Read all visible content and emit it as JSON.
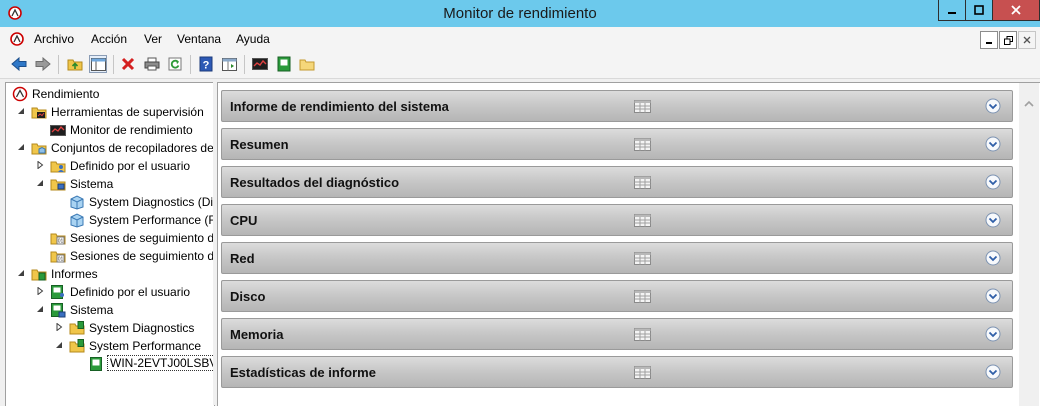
{
  "window": {
    "title": "Monitor de rendimiento",
    "icon": "perfmon-app-icon"
  },
  "menubar": {
    "items": [
      "Archivo",
      "Acción",
      "Ver",
      "Ventana",
      "Ayuda"
    ]
  },
  "toolbar": {
    "buttons": [
      "back-icon",
      "forward-icon",
      "up-folder-icon",
      "show-hide-tree-icon",
      "delete-icon",
      "print-icon",
      "refresh-icon",
      "help-icon",
      "properties-icon",
      "monitor-icon",
      "report-icon",
      "folder-icon"
    ]
  },
  "tree": {
    "items": [
      {
        "label": "Rendimiento",
        "icon": "perfmon-icon",
        "level": 0,
        "expander": ""
      },
      {
        "label": "Herramientas de supervisión",
        "icon": "tools-folder-icon",
        "level": 1,
        "expander": "expanded"
      },
      {
        "label": "Monitor de rendimiento",
        "icon": "graph-icon",
        "level": 2,
        "expander": ""
      },
      {
        "label": "Conjuntos de recopiladores de",
        "icon": "collector-folder-icon",
        "level": 1,
        "expander": "expanded"
      },
      {
        "label": "Definido por el usuario",
        "icon": "user-folder-icon",
        "level": 2,
        "expander": "collapsed"
      },
      {
        "label": "Sistema",
        "icon": "system-folder-icon",
        "level": 2,
        "expander": "expanded"
      },
      {
        "label": "System Diagnostics (Di",
        "icon": "data-collector-icon",
        "level": 3,
        "expander": ""
      },
      {
        "label": "System Performance (F",
        "icon": "data-collector-icon",
        "level": 3,
        "expander": ""
      },
      {
        "label": "Sesiones de seguimiento d",
        "icon": "trace-folder-icon",
        "level": 2,
        "expander": ""
      },
      {
        "label": "Sesiones de seguimiento d",
        "icon": "trace-folder-icon",
        "level": 2,
        "expander": ""
      },
      {
        "label": "Informes",
        "icon": "reports-folder-icon",
        "level": 1,
        "expander": "expanded"
      },
      {
        "label": "Definido por el usuario",
        "icon": "user-report-icon",
        "level": 2,
        "expander": "collapsed"
      },
      {
        "label": "Sistema",
        "icon": "system-report-icon",
        "level": 2,
        "expander": "expanded"
      },
      {
        "label": "System Diagnostics",
        "icon": "report-folder-icon",
        "level": 3,
        "expander": "collapsed"
      },
      {
        "label": "System Performance",
        "icon": "report-folder-icon",
        "level": 3,
        "expander": "expanded"
      },
      {
        "label": "WIN-2EVTJ00LSBV_",
        "icon": "report-icon",
        "level": 4,
        "expander": "",
        "selected": true
      }
    ]
  },
  "report": {
    "sections": [
      "Informe de rendimiento del sistema",
      "Resumen",
      "Resultados del diagnóstico",
      "CPU",
      "Red",
      "Disco",
      "Memoria",
      "Estadísticas de informe"
    ]
  },
  "colors": {
    "titlebar": "#6cc9ec",
    "close_button": "#c75050",
    "section_header_top": "#dcdcdc",
    "section_header_bottom": "#b5b5b5",
    "expand_button": "#2f5fa8"
  }
}
